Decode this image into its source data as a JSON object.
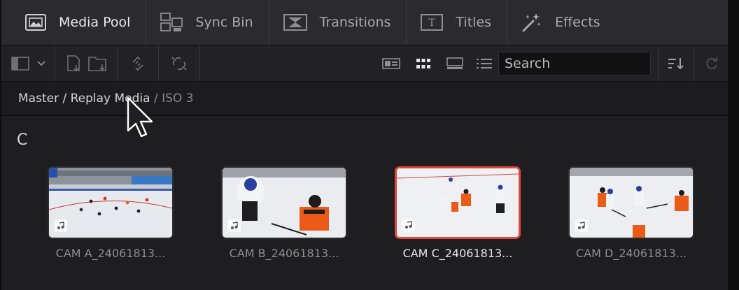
{
  "tabs": [
    {
      "label": "Media Pool",
      "icon": "media-pool-icon"
    },
    {
      "label": "Sync Bin",
      "icon": "sync-bin-icon"
    },
    {
      "label": "Transitions",
      "icon": "transitions-icon"
    },
    {
      "label": "Titles",
      "icon": "titles-icon"
    },
    {
      "label": "Effects",
      "icon": "effects-icon"
    }
  ],
  "search": {
    "placeholder": "Search"
  },
  "breadcrumb": {
    "part1": "Master",
    "sep1": " / ",
    "part2": "Replay Media",
    "sep2": " / ",
    "current": "ISO 3"
  },
  "group_letter": "C",
  "clips": [
    {
      "name": "CAM A_24061813...",
      "selected": false
    },
    {
      "name": "CAM B_24061813...",
      "selected": false
    },
    {
      "name": "CAM C_24061813...",
      "selected": true
    },
    {
      "name": "CAM D_24061813...",
      "selected": false
    }
  ],
  "colors": {
    "accent": "#e2473b",
    "background": "#1e1e21"
  }
}
